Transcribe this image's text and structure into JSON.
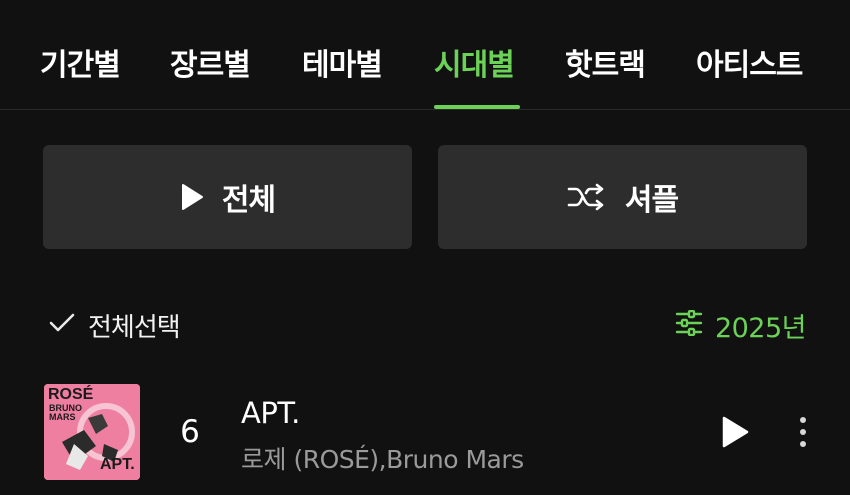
{
  "tabs": [
    {
      "label": "기간별",
      "active": false
    },
    {
      "label": "장르별",
      "active": false
    },
    {
      "label": "테마별",
      "active": false
    },
    {
      "label": "시대별",
      "active": true
    },
    {
      "label": "핫트랙",
      "active": false
    },
    {
      "label": "아티스트",
      "active": false
    }
  ],
  "actions": {
    "play_all_label": "전체",
    "shuffle_label": "셔플"
  },
  "list_controls": {
    "select_all_label": "전체선택",
    "year_filter_label": "2025년"
  },
  "tracks": [
    {
      "rank": "6",
      "title": "APT.",
      "artist": "로제 (ROSÉ),Bruno Mars",
      "cover": {
        "line1": "ROSÉ",
        "line2": "BRUNO",
        "line3": "MARS",
        "line4": "APT."
      }
    }
  ],
  "colors": {
    "accent": "#6cd257",
    "background": "#111111",
    "button": "#2d2d2d",
    "cover": "#ef7fa0"
  },
  "icons": {
    "play": "play-icon",
    "shuffle": "shuffle-icon",
    "check": "check-icon",
    "filter": "sliders-icon",
    "more": "more-vertical-icon"
  }
}
